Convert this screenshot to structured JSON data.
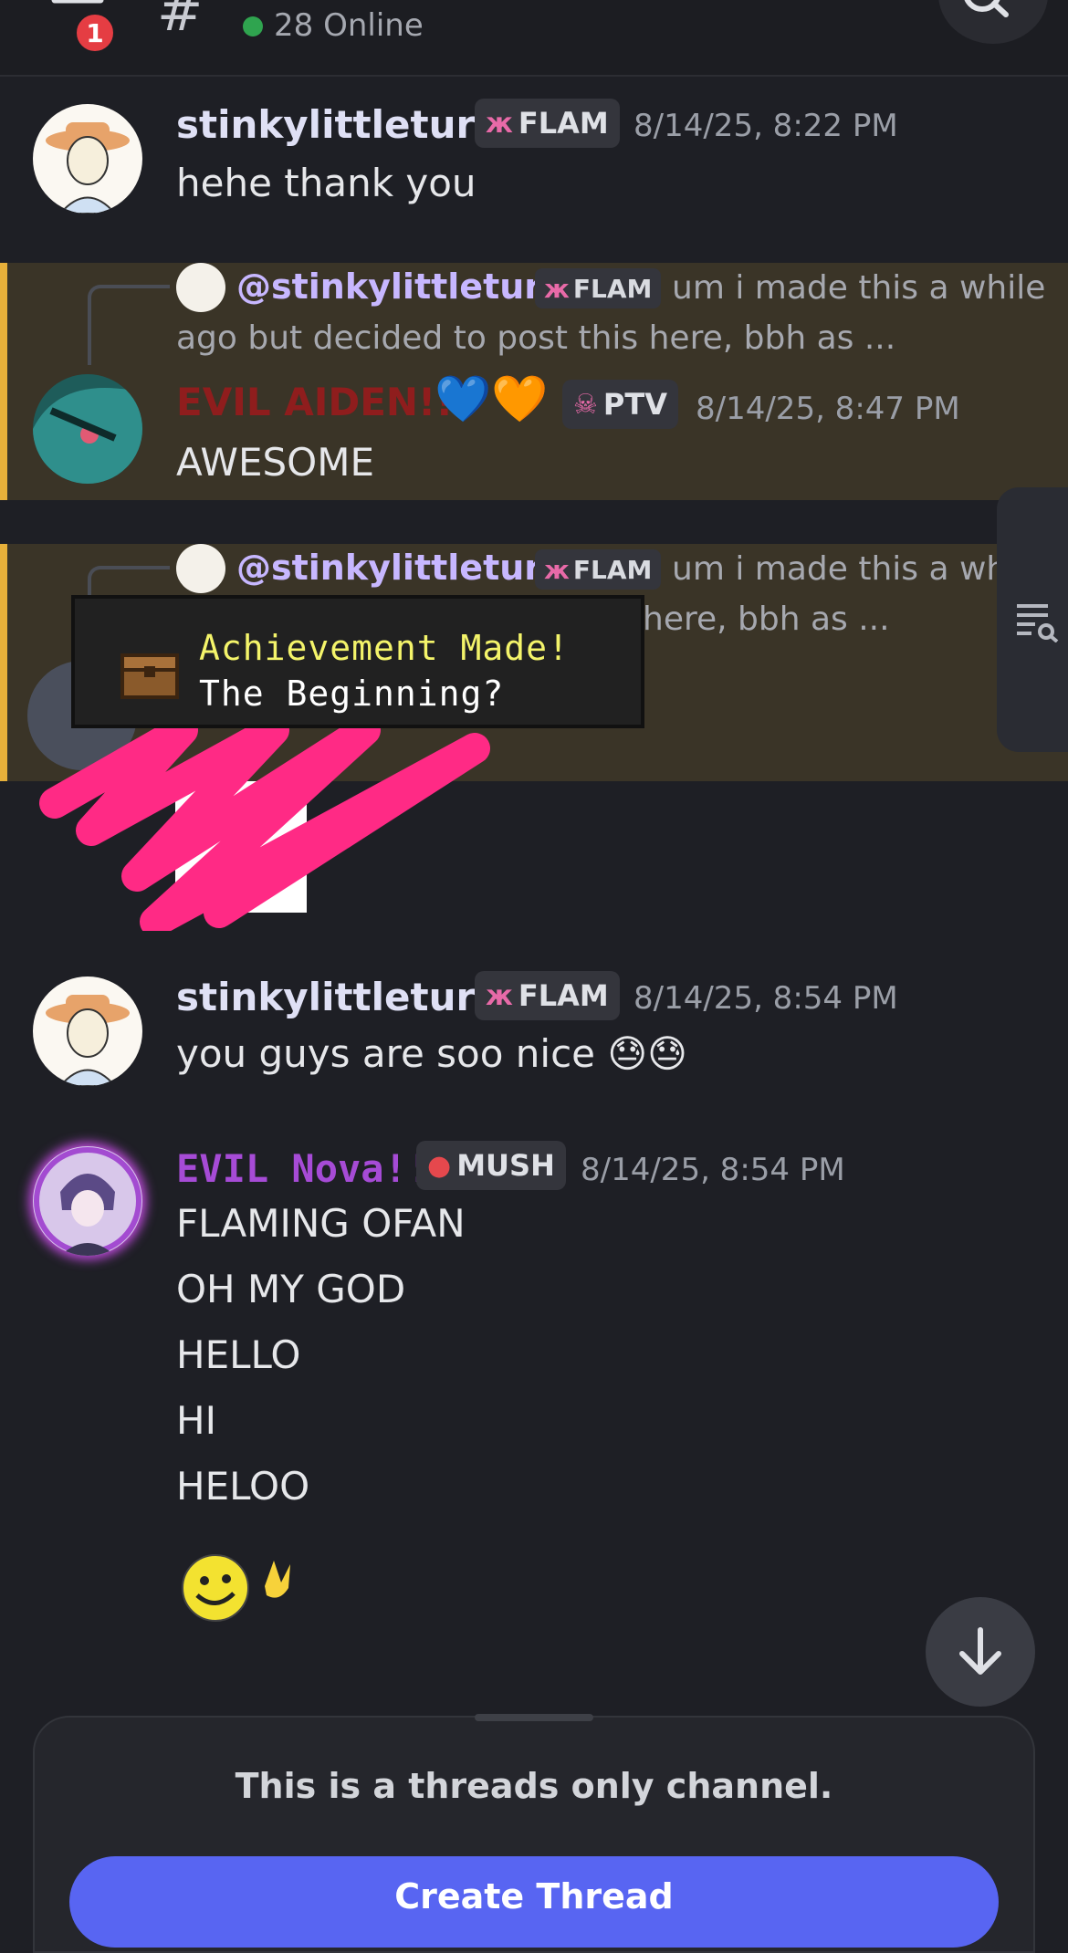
{
  "header": {
    "notification_count": "1",
    "online_count": "28 Online"
  },
  "messages": [
    {
      "author": "stinkylittleturd",
      "role_tag": "FLAM",
      "timestamp": "8/14/25, 8:22 PM",
      "lines": [
        "hehe thank you"
      ]
    },
    {
      "reply_to": "@stinkylittleturd",
      "reply_tag": "FLAM",
      "reply_preview_1": "um i made this a while",
      "reply_preview_2": "ago but decided to post this here, bbh as ...",
      "author": "EVIL AIDEN!!",
      "author_emoji": "💙🧡",
      "role_tag": "PTV",
      "timestamp": "8/14/25, 8:47 PM",
      "lines": [
        "AWESOME"
      ]
    },
    {
      "reply_to": "@stinkylittleturd",
      "reply_tag": "FLAM",
      "reply_preview_1": "um i made this a wh",
      "reply_preview_2": "here, bbh as ...",
      "achievement_title": "Achievement Made!",
      "achievement_sub": "The Beginning?"
    },
    {
      "author": "stinkylittleturd",
      "role_tag": "FLAM",
      "timestamp": "8/14/25, 8:54 PM",
      "lines": [
        "you guys are soo nice 😓😓"
      ]
    },
    {
      "author": "EVIL Nova!!",
      "role_tag": "MUSH",
      "timestamp": "8/14/25, 8:54 PM",
      "lines": [
        "FLAMING OFAN",
        "OH MY GOD",
        "HELLO",
        "HI",
        "HELOO"
      ]
    }
  ],
  "colors": {
    "background": "#1e1f25",
    "reply_highlight": "#3a3427",
    "accent_bar": "#e7b03a",
    "aiden_name": "#8f1d1d",
    "nova_name": "#a64bd6",
    "button": "#5865f2",
    "scribble": "#ff2a85"
  },
  "footer": {
    "notice": "This is a threads only channel.",
    "button_label": "Create Thread"
  }
}
